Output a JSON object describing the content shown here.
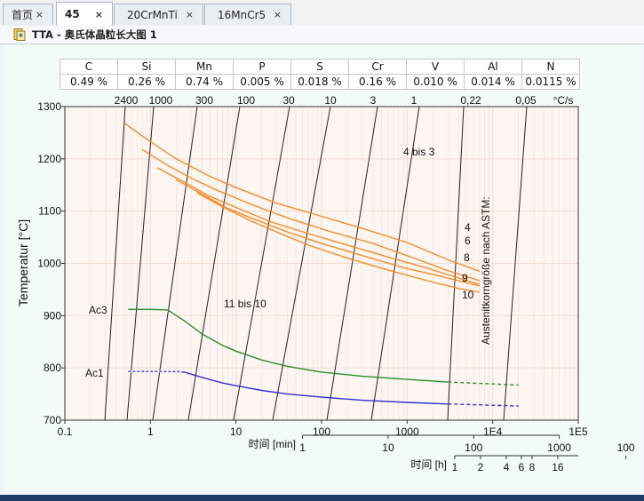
{
  "tabs": [
    {
      "label": "首页",
      "active": false
    },
    {
      "label": "45",
      "active": true
    },
    {
      "label": "20CrMnTi",
      "active": false
    },
    {
      "label": "16MnCr5",
      "active": false
    }
  ],
  "tab_close": "×",
  "document": {
    "title": "TTA - 奥氏体晶粒长大图 1"
  },
  "composition": {
    "elements": [
      "C",
      "Si",
      "Mn",
      "P",
      "S",
      "Cr",
      "V",
      "Al",
      "N"
    ],
    "values": [
      "0.49 %",
      "0.26 %",
      "0.74 %",
      "0.005 %",
      "0.018 %",
      "0.16 %",
      "0.010 %",
      "0.014 %",
      "0.0115 %"
    ]
  },
  "chart_data": {
    "type": "line",
    "ylabel": "Temperatur [°C]",
    "ylim": [
      700,
      1300
    ],
    "y_ticks": [
      700,
      800,
      900,
      1000,
      1100,
      1200,
      1300
    ],
    "x_scale": "log",
    "xlim": [
      0.1,
      100000
    ],
    "x_ticks": [
      "0.1",
      "1",
      "10",
      "100",
      "1000",
      "1E4",
      "1E5"
    ],
    "time_unit_min": {
      "label": "时间 [min]",
      "ticks": [
        "1",
        "10",
        "100",
        "1000"
      ]
    },
    "time_unit_h": {
      "label": "时间 [h]",
      "ticks": [
        "1",
        "2",
        "4",
        "6",
        "8",
        "16",
        "100",
        "1000"
      ]
    },
    "heating_rates": {
      "unit": "°C/s",
      "labels": [
        "2400",
        "1000",
        "300",
        "100",
        "30",
        "10",
        "3",
        "1",
        "0.22",
        "0.05"
      ]
    },
    "grain_size_group_labels": [
      "4 bis 3",
      "11 bis 10"
    ],
    "grain_size_axis_label": "Austenitkorngröße nach ASTM:",
    "series": [
      {
        "name": "Ac3",
        "color": "#2a8c2a",
        "x": [
          0.55,
          1.0,
          1.6,
          2.5,
          4,
          7,
          10,
          20,
          40,
          100,
          300,
          1000,
          3000,
          8000,
          20000
        ],
        "y": [
          912,
          912,
          911,
          890,
          865,
          843,
          832,
          815,
          803,
          792,
          784,
          778,
          773,
          770,
          767
        ]
      },
      {
        "name": "Ac1",
        "color": "#2b33d0",
        "x": [
          0.55,
          1.0,
          1.6,
          2.5,
          4,
          7,
          10,
          20,
          40,
          100,
          300,
          1000,
          3000,
          8000,
          20000
        ],
        "y": [
          793,
          793,
          793,
          792,
          782,
          771,
          766,
          757,
          750,
          744,
          738,
          734,
          731,
          729,
          727
        ]
      },
      {
        "name": "4",
        "color": "#f08c28",
        "x": [
          0.5,
          1,
          2,
          5,
          10,
          30,
          100,
          300,
          1000,
          3000,
          7000
        ],
        "y": [
          1268,
          1233,
          1200,
          1166,
          1145,
          1115,
          1090,
          1067,
          1040,
          1007,
          985
        ]
      },
      {
        "name": "6",
        "color": "#f08c28",
        "x": [
          0.8,
          1.5,
          3,
          6,
          15,
          40,
          120,
          400,
          1200,
          3000,
          7000
        ],
        "y": [
          1218,
          1190,
          1163,
          1140,
          1113,
          1087,
          1062,
          1038,
          1010,
          986,
          967
        ]
      },
      {
        "name": "8",
        "color": "#f08c28",
        "x": [
          1.2,
          2.5,
          5,
          10,
          25,
          70,
          200,
          600,
          1800,
          4000,
          7000
        ],
        "y": [
          1183,
          1155,
          1128,
          1107,
          1080,
          1057,
          1035,
          1012,
          990,
          972,
          960
        ]
      },
      {
        "name": "9",
        "color": "#f08c28",
        "x": [
          2,
          4,
          8,
          15,
          40,
          100,
          300,
          900,
          2500,
          5000,
          7000
        ],
        "y": [
          1160,
          1133,
          1105,
          1087,
          1060,
          1038,
          1015,
          992,
          975,
          963,
          957
        ]
      },
      {
        "name": "10",
        "color": "#f08c28",
        "x": [
          3.5,
          7,
          15,
          30,
          70,
          200,
          600,
          1800,
          4000,
          7000
        ],
        "y": [
          1135,
          1108,
          1081,
          1060,
          1035,
          1010,
          987,
          966,
          952,
          945
        ]
      }
    ],
    "curve_labels": [
      "4",
      "6",
      "8",
      "9",
      "10",
      "Ac3",
      "Ac1"
    ]
  }
}
